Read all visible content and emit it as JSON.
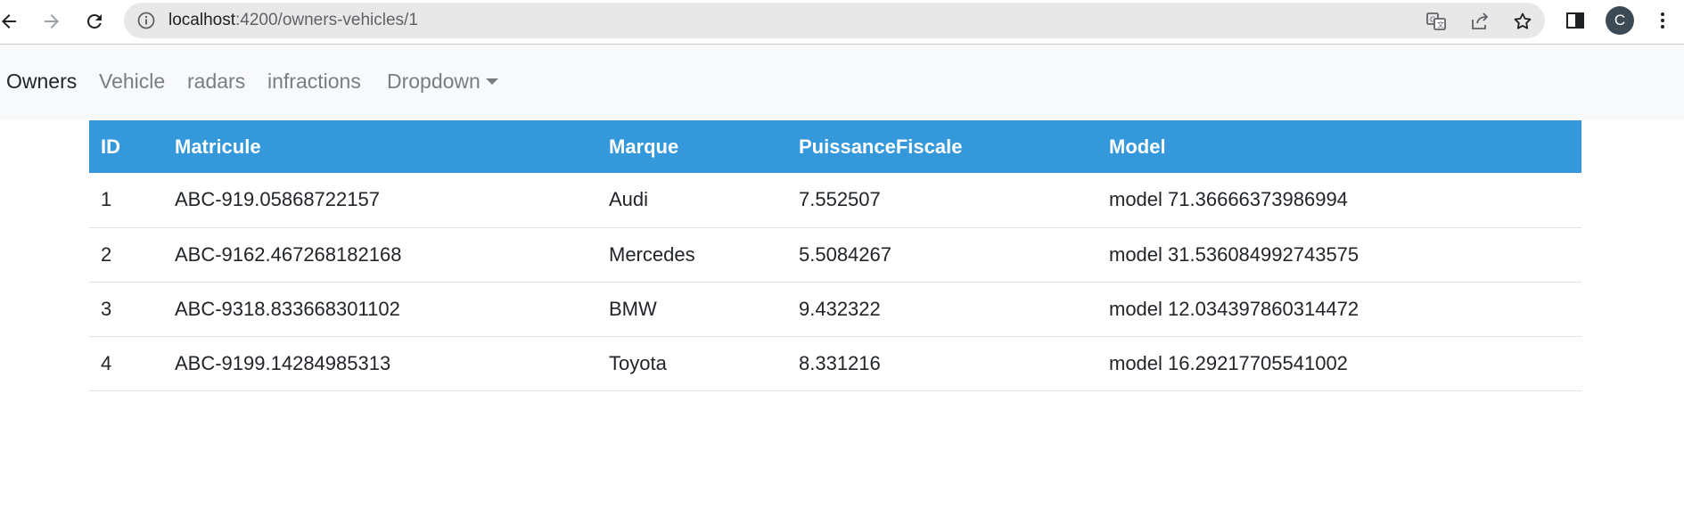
{
  "browser": {
    "url_host": "localhost",
    "url_path": ":4200/owners-vehicles/1",
    "profile_initial": "C"
  },
  "navbar": {
    "links": [
      {
        "label": "Owners",
        "active": true
      },
      {
        "label": "Vehicle",
        "active": false
      },
      {
        "label": "radars",
        "active": false
      },
      {
        "label": "infractions",
        "active": false
      },
      {
        "label": "Dropdown",
        "active": false
      }
    ]
  },
  "table": {
    "header_color": "#3498db",
    "columns": [
      "ID",
      "Matricule",
      "Marque",
      "PuissanceFiscale",
      "Model"
    ],
    "rows": [
      {
        "id": "1",
        "matricule": "ABC-919.05868722157",
        "marque": "Audi",
        "puissance": "7.552507",
        "model": "model 71.36666373986994"
      },
      {
        "id": "2",
        "matricule": "ABC-9162.467268182168",
        "marque": "Mercedes",
        "puissance": "5.5084267",
        "model": "model 31.536084992743575"
      },
      {
        "id": "3",
        "matricule": "ABC-9318.833668301102",
        "marque": "BMW",
        "puissance": "9.432322",
        "model": "model 12.034397860314472"
      },
      {
        "id": "4",
        "matricule": "ABC-9199.14284985313",
        "marque": "Toyota",
        "puissance": "8.331216",
        "model": "model 16.29217705541002"
      }
    ]
  }
}
